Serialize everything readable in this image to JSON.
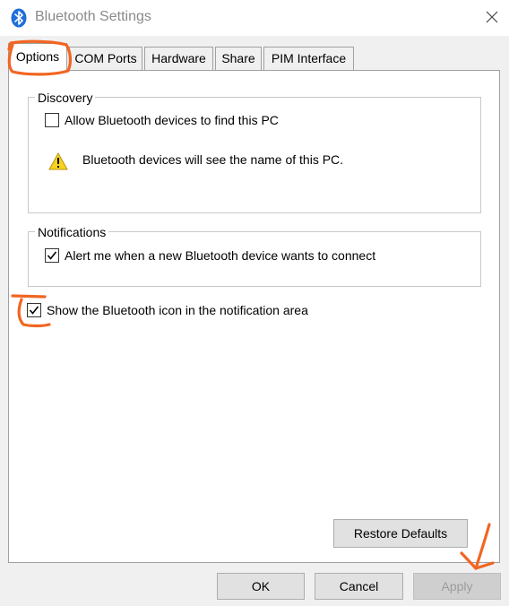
{
  "window": {
    "title": "Bluetooth Settings",
    "app_icon": "bluetooth-icon",
    "close_icon": "close-icon"
  },
  "tabs": [
    {
      "label": "Options",
      "active": true
    },
    {
      "label": "COM Ports",
      "active": false
    },
    {
      "label": "Hardware",
      "active": false
    },
    {
      "label": "Share",
      "active": false
    },
    {
      "label": "PIM Interface",
      "active": false
    }
  ],
  "discovery": {
    "group_label": "Discovery",
    "allow_find": {
      "label": "Allow Bluetooth devices to find this PC",
      "checked": false
    },
    "warning": {
      "icon": "warning-icon",
      "text": "Bluetooth devices will see the name of this PC."
    }
  },
  "notifications": {
    "group_label": "Notifications",
    "alert_new_device": {
      "label": "Alert me when a new Bluetooth device wants to connect",
      "checked": true
    }
  },
  "show_icon": {
    "label": "Show the Bluetooth icon in the notification area",
    "checked": true
  },
  "buttons": {
    "restore_defaults": "Restore Defaults",
    "ok": "OK",
    "cancel": "Cancel",
    "apply": "Apply",
    "apply_enabled": false
  },
  "colors": {
    "bluetooth_blue": "#1e6fd9",
    "annotation_orange": "#f26522",
    "warning_yellow": "#f7d21e"
  }
}
